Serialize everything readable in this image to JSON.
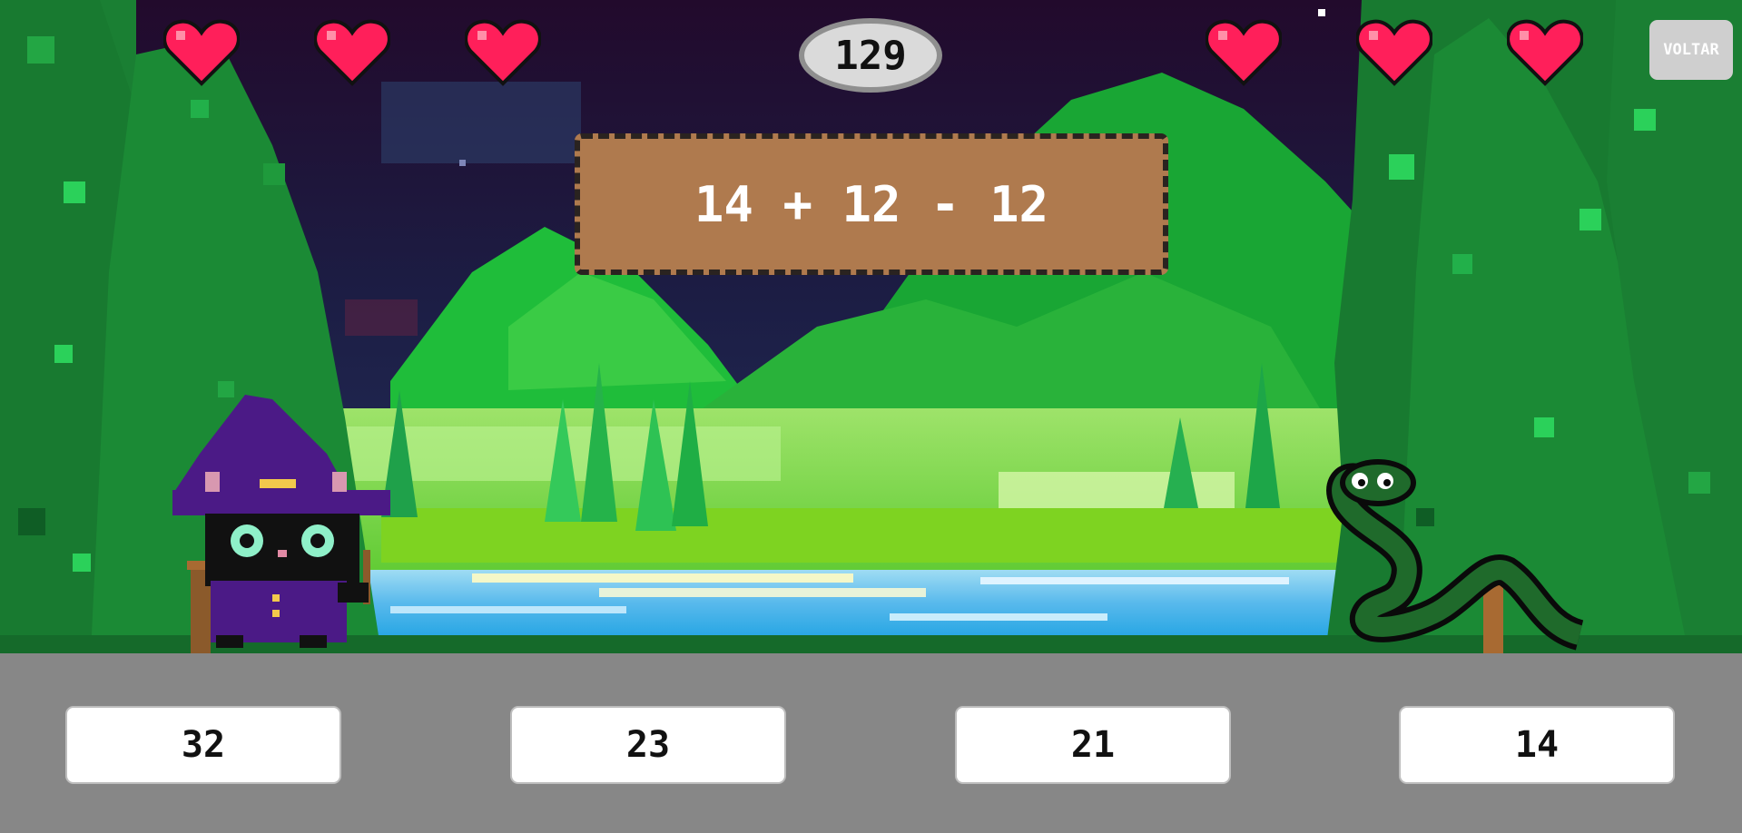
{
  "game": {
    "score": "129",
    "back_label": "VOLTAR",
    "question": "14 + 12 - 12",
    "player_lives": 3,
    "enemy_lives": 3,
    "answers": [
      "32",
      "23",
      "21",
      "14"
    ]
  },
  "icons": {
    "life": "heart-icon",
    "player": "wizard-cat",
    "enemy": "snake"
  },
  "colors": {
    "heart": "#ff1f5a",
    "sky": "#1c0f2e",
    "box": "#af7a4e",
    "bar": "#878787"
  }
}
